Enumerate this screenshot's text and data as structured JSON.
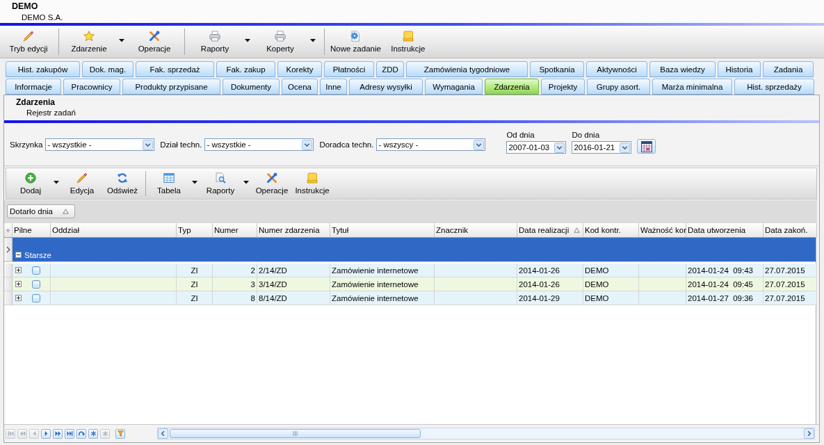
{
  "header": {
    "title": "DEMO",
    "subtitle": "DEMO S.A."
  },
  "toolbar": {
    "groups": [
      {
        "buttons": [
          {
            "label": "Tryb edycji",
            "dropdown": false
          }
        ]
      },
      {
        "buttons": [
          {
            "label": "Zdarzenie",
            "dropdown": true
          },
          {
            "label": "Operacje",
            "dropdown": false
          }
        ]
      },
      {
        "buttons": [
          {
            "label": "Raporty",
            "dropdown": true
          },
          {
            "label": "Koperty",
            "dropdown": true
          }
        ]
      },
      {
        "buttons": [
          {
            "label": "Nowe zadanie",
            "dropdown": false
          },
          {
            "label": "Instrukcje",
            "dropdown": false
          }
        ]
      }
    ]
  },
  "tab_strip": {
    "rows": [
      {
        "tabs": [
          {
            "label": "Hist. zakupów",
            "selected": false
          },
          {
            "label": "Dok. mag.",
            "selected": false
          },
          {
            "label": "Fak. sprzedaż",
            "selected": false
          },
          {
            "label": "Fak. zakup",
            "selected": false
          },
          {
            "label": "Korekty",
            "selected": false
          },
          {
            "label": "Płatności",
            "selected": false
          },
          {
            "label": "ZDD",
            "selected": false
          },
          {
            "label": "Zamówienia tygodniowe",
            "selected": false
          },
          {
            "label": "Spotkania",
            "selected": false
          },
          {
            "label": "Aktywności",
            "selected": false
          },
          {
            "label": "Baza wiedzy",
            "selected": false
          },
          {
            "label": "Historia",
            "selected": false
          },
          {
            "label": "Zadania",
            "selected": false
          }
        ]
      },
      {
        "tabs": [
          {
            "label": "Informacje",
            "selected": false
          },
          {
            "label": "Pracownicy",
            "selected": false
          },
          {
            "label": "Produkty przypisane",
            "selected": false
          },
          {
            "label": "Dokumenty",
            "selected": false
          },
          {
            "label": "Ocena",
            "selected": false
          },
          {
            "label": "Inne",
            "selected": false
          },
          {
            "label": "Adresy wysyłki",
            "selected": false
          },
          {
            "label": "Wymagania",
            "selected": false
          },
          {
            "label": "Zdarzenia",
            "selected": true
          },
          {
            "label": "Projekty",
            "selected": false
          },
          {
            "label": "Grupy asort.",
            "selected": false
          },
          {
            "label": "Marża minimalna",
            "selected": false
          },
          {
            "label": "Hist. sprzedaży",
            "selected": false
          }
        ]
      }
    ]
  },
  "section": {
    "title": "Zdarzenia",
    "subtitle": "Rejestr zadań"
  },
  "filters": [
    {
      "label": "Skrzynka",
      "value": "- wszystkie -"
    },
    {
      "label": "Dział techn.",
      "value": "- wszystkie -"
    },
    {
      "label": "Doradca techn.",
      "value": "- wszyscy -"
    }
  ],
  "date_range": [
    {
      "label": "Od dnia",
      "value": "2007-01-03"
    },
    {
      "label": "Do dnia",
      "value": "2016-01-21"
    }
  ],
  "grid_toolbar": {
    "groups": [
      {
        "buttons": [
          {
            "label": "Dodaj",
            "dropdown": true
          },
          {
            "label": "Edycja",
            "dropdown": false
          },
          {
            "label": "Odśwież",
            "dropdown": false
          }
        ]
      },
      {
        "buttons": [
          {
            "label": "Tabela",
            "dropdown": true
          },
          {
            "label": "Raporty",
            "dropdown": true
          },
          {
            "label": "Operacje",
            "dropdown": false
          },
          {
            "label": "Instrukcje",
            "dropdown": false
          }
        ]
      }
    ]
  },
  "grouping": {
    "label": "Dotarło dnia",
    "sorted": true
  },
  "table": {
    "columns": [
      {
        "label": "Pilne",
        "sorted": false
      },
      {
        "label": "Oddział",
        "sorted": false
      },
      {
        "label": "Typ",
        "sorted": false
      },
      {
        "label": "Numer",
        "sorted": false
      },
      {
        "label": "Numer zdarzenia",
        "sorted": false
      },
      {
        "label": "Tytuł",
        "sorted": false
      },
      {
        "label": "Znacznik",
        "sorted": false
      },
      {
        "label": "Data realizacji",
        "sorted": true
      },
      {
        "label": "Kod kontr.",
        "sorted": false
      },
      {
        "label": "Ważność kor",
        "sorted": false
      },
      {
        "label": "Data utworzenia",
        "sorted": false
      },
      {
        "label": "Data zakoń.",
        "sorted": false
      }
    ],
    "groups": [
      {
        "label": "Starsze",
        "expanded": true,
        "selected": true,
        "rows": [
          {
            "selected": false,
            "expanded": false,
            "urgent": false,
            "typ": "ZI",
            "numer": "2",
            "numer_zdarzenia": "2/14/ZD",
            "tytul": "Zamówienie internetowe",
            "data_realizacji": "2014-01-26",
            "kod_kontr": "DEMO",
            "data_utworzenia": "2014-01-24  09:43",
            "data_zakonczenia": "27.07.2015"
          },
          {
            "selected": false,
            "expanded": false,
            "urgent": false,
            "typ": "ZI",
            "numer": "3",
            "numer_zdarzenia": "3/14/ZD",
            "tytul": "Zamówienie internetowe",
            "data_realizacji": "2014-01-26",
            "kod_kontr": "DEMO",
            "data_utworzenia": "2014-01-24  09:45",
            "data_zakonczenia": "27.07.2015"
          },
          {
            "selected": false,
            "expanded": false,
            "urgent": false,
            "typ": "ZI",
            "numer": "8",
            "numer_zdarzenia": "8/14/ZD",
            "tytul": "Zamówienie internetowe",
            "data_realizacji": "2014-01-29",
            "kod_kontr": "DEMO",
            "data_utworzenia": "2014-01-27  09:36",
            "data_zakonczenia": "27.07.2015"
          }
        ]
      }
    ]
  },
  "pager": [
    {
      "disabled": true
    },
    {
      "disabled": true
    },
    {
      "disabled": true
    },
    {
      "disabled": false
    },
    {
      "disabled": false
    },
    {
      "disabled": false
    },
    {
      "disabled": false
    },
    {
      "disabled": false
    },
    {
      "disabled": true
    },
    {
      "disabled": false
    }
  ]
}
